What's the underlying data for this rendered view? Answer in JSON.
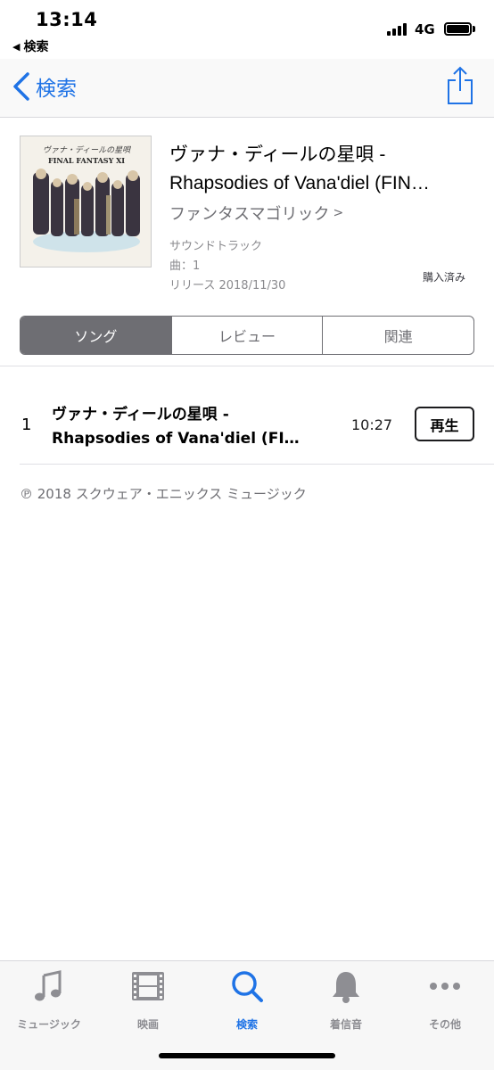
{
  "status": {
    "time": "13:14",
    "back_app": "検索",
    "network": "4G"
  },
  "nav": {
    "back_label": "検索"
  },
  "album": {
    "title_line1": "ヴァナ・ディールの星唄 -",
    "title_line2": "Rhapsodies of Vana'diel (FIN…",
    "artist": "ファンタスマゴリック",
    "genre": "サウンドトラック",
    "track_count": "曲：1",
    "release": "リリース 2018/11/30",
    "purchased": "購入済み",
    "artwork_jp": "ヴァナ・ディールの星唄",
    "artwork_logo": "FINAL FANTASY XI"
  },
  "segments": [
    "ソング",
    "レビュー",
    "関連"
  ],
  "tracks": [
    {
      "number": "1",
      "title_line1": "ヴァナ・ディールの星唄 -",
      "title_line2": "Rhapsodies of Vana'diel (FI…",
      "duration": "10:27",
      "action": "再生"
    }
  ],
  "copyright": "℗ 2018 スクウェア・エニックス ミュージック",
  "tabs": [
    {
      "label": "ミュージック",
      "icon": "music-note-icon"
    },
    {
      "label": "映画",
      "icon": "film-icon"
    },
    {
      "label": "検索",
      "icon": "search-icon"
    },
    {
      "label": "着信音",
      "icon": "bell-icon"
    },
    {
      "label": "その他",
      "icon": "more-icon"
    }
  ],
  "colors": {
    "accent": "#1f73e6",
    "tab_inactive": "#8e8e93",
    "segment_selected": "#6e6e73"
  }
}
